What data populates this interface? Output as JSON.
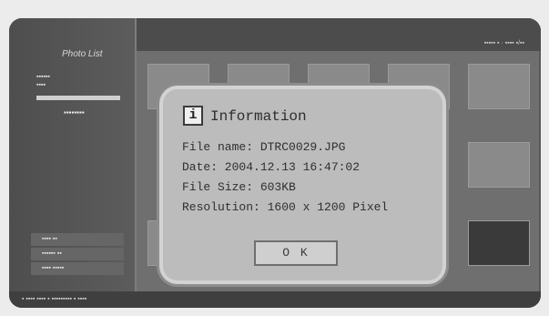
{
  "background": {
    "sidebar_title": "Photo List"
  },
  "dialog": {
    "title": "Information",
    "lines": [
      "File name: DTRC0029.JPG",
      "Date: 2004.12.13    16:47:02",
      "File Size: 603KB",
      "Resolution: 1600 x 1200 Pixel"
    ],
    "ok_label": "O K",
    "icon": "info-icon"
  }
}
